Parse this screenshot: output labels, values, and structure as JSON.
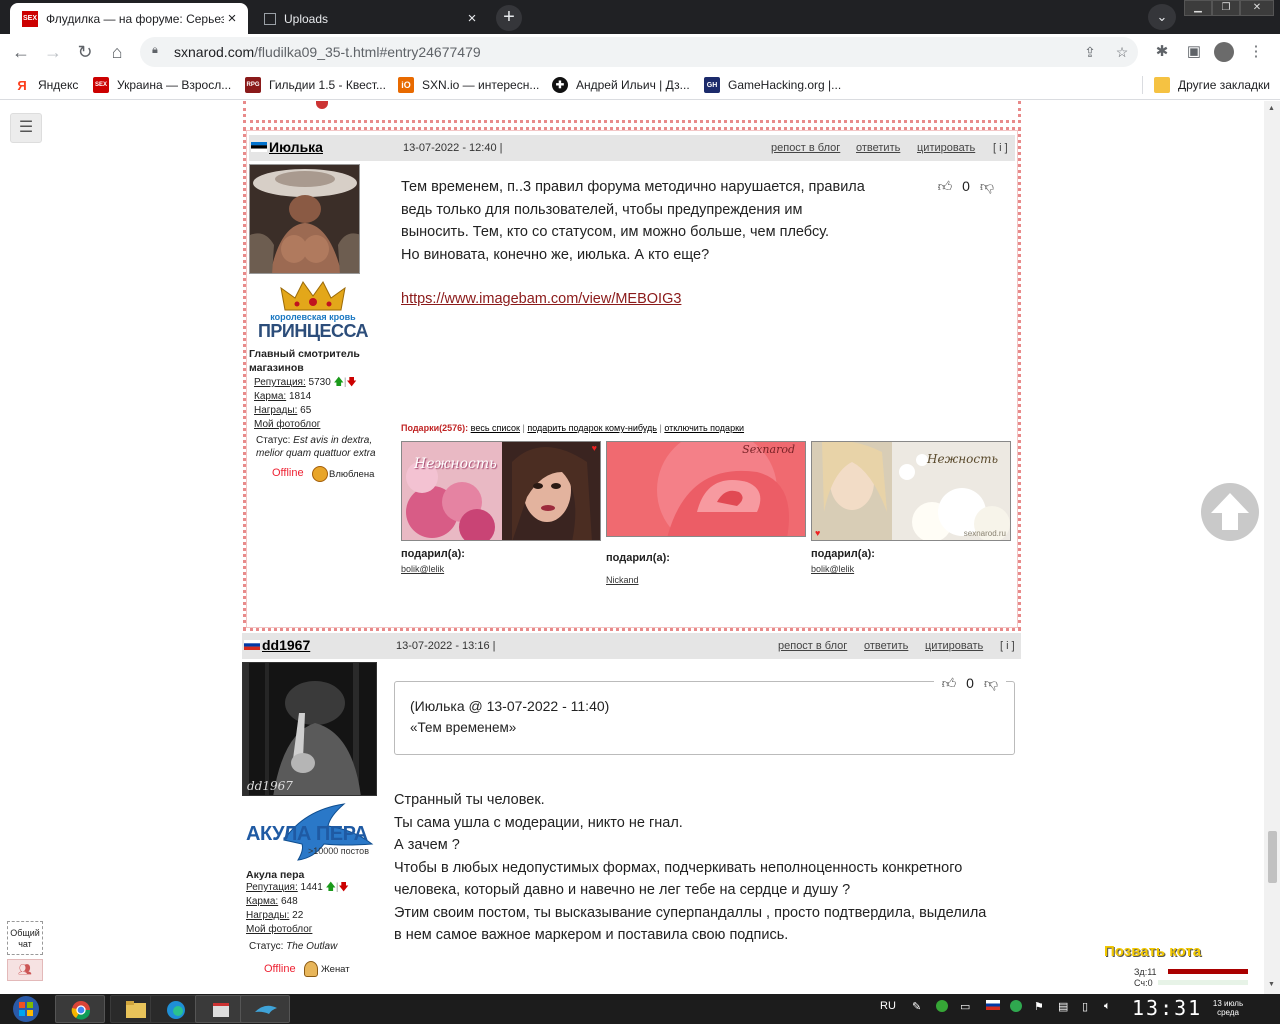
{
  "browser": {
    "tabs": [
      {
        "title": "Флудилка — на форуме: Серьез",
        "favicon": "SEX",
        "active": true
      },
      {
        "title": "Uploads",
        "active": false
      }
    ],
    "url_main": "sxnarod.com",
    "url_path": "/fludilka09_35-t.html#entry24677479",
    "bookmarks": [
      {
        "label": "Яндекс",
        "icon": "Я",
        "color": "#fc3f1d"
      },
      {
        "label": "Украина — Взросл...",
        "icon": "SEX",
        "color": "#c00"
      },
      {
        "label": "Гильдии 1.5 - Квест...",
        "icon": "RPG",
        "color": "#8a1a1a"
      },
      {
        "label": "SXN.io — интересн...",
        "icon": "iO",
        "color": "#e86a00"
      },
      {
        "label": "Андрей Ильич | Дз...",
        "icon": "✚",
        "color": "#111"
      },
      {
        "label": "GameHacking.org |...",
        "icon": "GH",
        "color": "#1c2b6b"
      }
    ],
    "other_bookmarks": "Другие закладки"
  },
  "post1": {
    "nick": "Июлька",
    "date": "13-07-2022 - 12:40 |",
    "actions": {
      "repost": "репост в блог",
      "reply": "ответить",
      "quote": "цитировать",
      "info": "[ i ]"
    },
    "crown_label_top": "королевская кровь",
    "crown_label_main": "ПРИНЦЕССА",
    "role": "Главный смотритель магазинов",
    "reputation_label": "Репутация:",
    "reputation": "5730",
    "karma_label": "Карма:",
    "karma": "1814",
    "awards_label": "Награды:",
    "awards": "65",
    "photoblog": "Мой фотоблог",
    "status_label": "Статус:",
    "status": "Est avis in dextra, melior quam quattuor extra",
    "offline": "Offline",
    "mood": "Влюблена",
    "votes": "0",
    "text_lines": [
      "Тем временем, п..3 правил форума методично нарушается, правила",
      "ведь только для пользователей, чтобы предупреждения им",
      "выносить. Тем, кто со статусом, им можно больше, чем плебсу.",
      "Но виновата, конечно же, июлька. А кто еще?"
    ],
    "link": "https://www.imagebam.com/view/MEBOIG3",
    "gifts_label": "Подарки(2576):",
    "gifts_all": "весь список",
    "gifts_give": "подарить подарок кому-нибудь",
    "gifts_off": "отключить подарки",
    "gifts": [
      {
        "caption": "подарил(а):",
        "by": "bolik@lelik",
        "text": "Нежность"
      },
      {
        "caption": "подарил(а):",
        "by": "Nickand",
        "text": "Sexnarod"
      },
      {
        "caption": "подарил(а):",
        "by": "bolik@lelik",
        "text": "Нежность",
        "footer": "sexnarod.ru"
      }
    ]
  },
  "post2": {
    "nick": "dd1967",
    "date": "13-07-2022 - 13:16 |",
    "actions": {
      "repost": "репост в блог",
      "reply": "ответить",
      "quote": "цитировать",
      "info": "[ i ]"
    },
    "avatar_sign": "dd1967",
    "badge_main": "АКУЛА ПЕРА",
    "badge_sub": ">10000 постов",
    "role": "Акула пера",
    "reputation_label": "Репутация:",
    "reputation": "1441",
    "karma_label": "Карма:",
    "karma": "648",
    "awards_label": "Награды:",
    "awards": "22",
    "photoblog": "Мой фотоблог",
    "status_label": "Статус:",
    "status": "The Outlaw",
    "offline": "Offline",
    "mood": "Женат",
    "votes": "0",
    "quote_head": "(Июлька @ 13-07-2022 - 11:40)",
    "quote_text": "«Тем временем»",
    "text_lines": [
      "Странный ты человек.",
      "Ты сама ушла с модерации, никто не гнал.",
      "А зачем ?",
      "Чтобы в любых недопустимых формах, подчеркивать неполноценность конкретного",
      "человека, который давно и навечно не лег тебе на сердце и душу ?",
      "Этим своим постом, ты высказывание суперпандаллы , просто подтвердила, выделила",
      "в нем самое важное маркером и поставила свою подпись."
    ]
  },
  "widgets": {
    "chat_label": "Общий чат",
    "call_cat": "Позвать кота",
    "bar1": "Зд:11",
    "bar2": "Сч:0"
  },
  "taskbar": {
    "lang": "RU",
    "time": "13:31",
    "date_line1": "13 июль",
    "date_line2": "среда"
  }
}
